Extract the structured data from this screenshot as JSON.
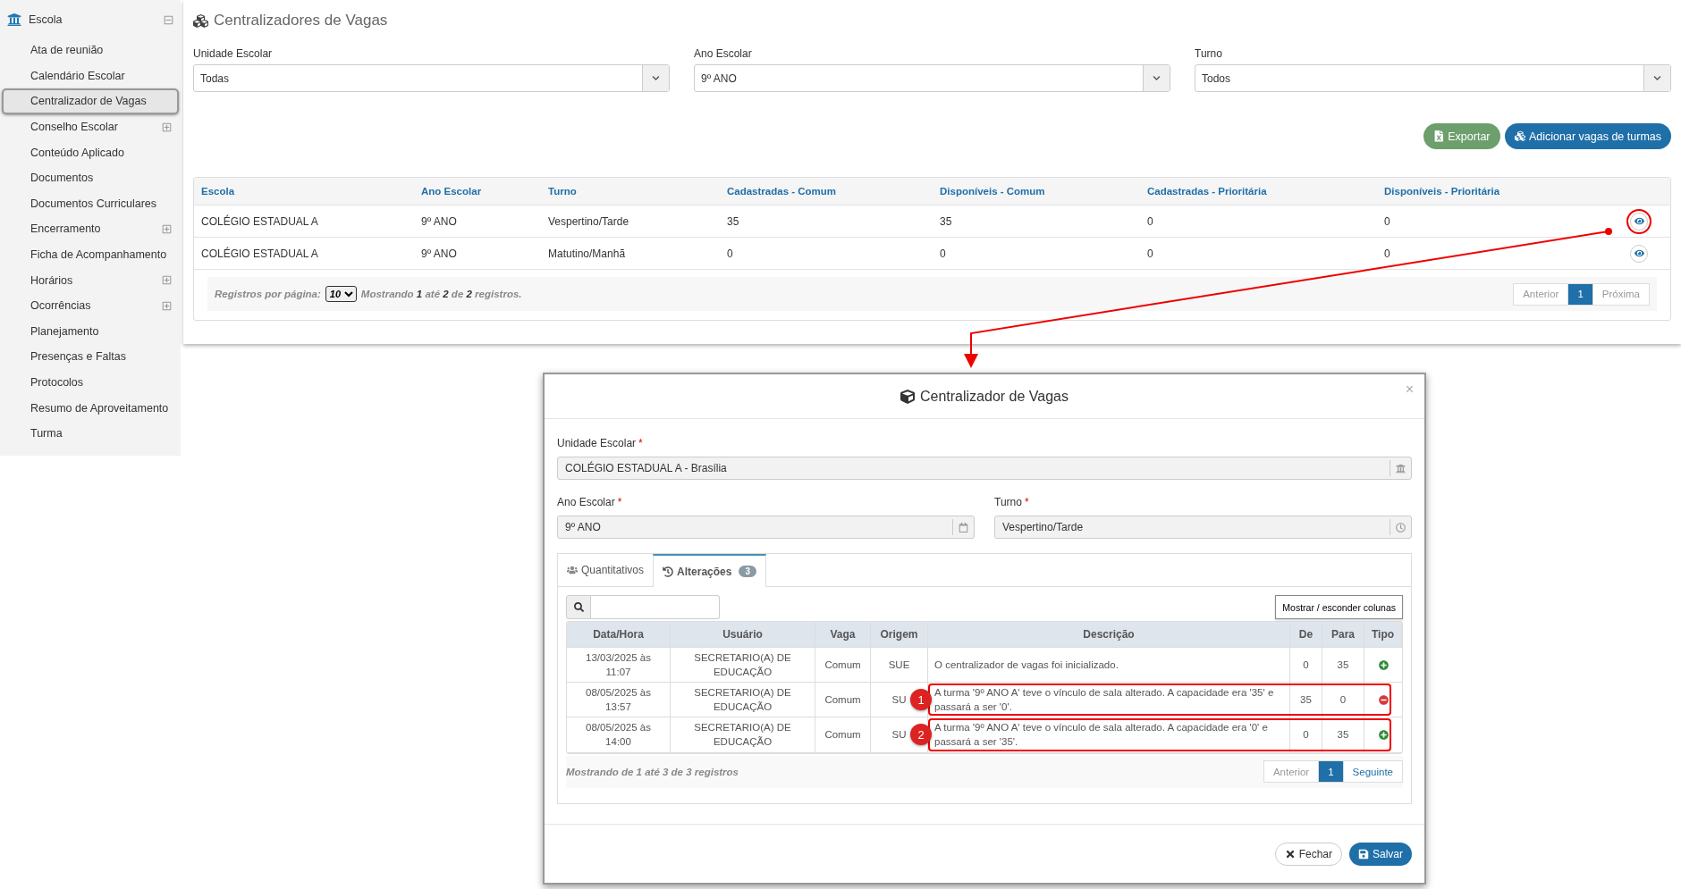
{
  "sidebar": {
    "section": {
      "label": "Escola",
      "expanded": true
    },
    "items": [
      {
        "label": "Ata de reunião",
        "selected": false,
        "expandable": false
      },
      {
        "label": "Calendário Escolar",
        "selected": false,
        "expandable": false
      },
      {
        "label": "Centralizador de Vagas",
        "selected": true,
        "expandable": false
      },
      {
        "label": "Conselho Escolar",
        "selected": false,
        "expandable": true
      },
      {
        "label": "Conteúdo Aplicado",
        "selected": false,
        "expandable": false
      },
      {
        "label": "Documentos",
        "selected": false,
        "expandable": false
      },
      {
        "label": "Documentos Curriculares",
        "selected": false,
        "expandable": false
      },
      {
        "label": "Encerramento",
        "selected": false,
        "expandable": true
      },
      {
        "label": "Ficha de Acompanhamento",
        "selected": false,
        "expandable": false
      },
      {
        "label": "Horários",
        "selected": false,
        "expandable": true
      },
      {
        "label": "Ocorrências",
        "selected": false,
        "expandable": true
      },
      {
        "label": "Planejamento",
        "selected": false,
        "expandable": false
      },
      {
        "label": "Presenças e Faltas",
        "selected": false,
        "expandable": false
      },
      {
        "label": "Protocolos",
        "selected": false,
        "expandable": false
      },
      {
        "label": "Resumo de Aproveitamento",
        "selected": false,
        "expandable": false
      },
      {
        "label": "Turma",
        "selected": false,
        "expandable": false
      }
    ]
  },
  "main": {
    "title": "Centralizadores de Vagas",
    "filters": [
      {
        "label": "Unidade Escolar",
        "value": "Todas"
      },
      {
        "label": "Ano Escolar",
        "value": "9º ANO"
      },
      {
        "label": "Turno",
        "value": "Todos"
      }
    ],
    "buttons": [
      {
        "label": "Exportar",
        "kind": "export"
      },
      {
        "label": "Adicionar vagas de turmas",
        "kind": "add"
      }
    ],
    "table": {
      "columns": [
        "Escola",
        "Ano Escolar",
        "Turno",
        "Cadastradas - Comum",
        "Disponíveis - Comum",
        "Cadastradas - Prioritária",
        "Disponíveis - Prioritária"
      ],
      "rows": [
        {
          "cells": [
            "COLÉGIO ESTADUAL A",
            "9º ANO",
            "Vespertino/Tarde",
            "35",
            "35",
            "0",
            "0"
          ],
          "highlighted": true
        },
        {
          "cells": [
            "COLÉGIO ESTADUAL A",
            "9º ANO",
            "Matutino/Manhã",
            "0",
            "0",
            "0",
            "0"
          ],
          "highlighted": false
        }
      ],
      "per_page_label": "Registros por página:",
      "per_page": "10",
      "info": "Mostrando **1** até **2** de **2** registros.",
      "pagination": [
        {
          "label": "Anterior",
          "selected": false
        },
        {
          "label": "1",
          "selected": true
        },
        {
          "label": "Próxima",
          "selected": false
        }
      ]
    }
  },
  "modal": {
    "title": "Centralizador de Vagas",
    "close": "×",
    "fields": [
      {
        "label": "Unidade Escolar",
        "required_mark": "*",
        "value": "COLÉGIO ESTADUAL A - Brasília",
        "kind": "school"
      },
      {
        "label": "Ano Escolar",
        "required_mark": "*",
        "value": "9º ANO",
        "kind": "calendar"
      },
      {
        "label": "Turno",
        "required_mark": "*",
        "value": "Vespertino/Tarde",
        "kind": "clock"
      }
    ],
    "tabs": [
      {
        "label": "Quantitativos",
        "selected": false,
        "kind": "users"
      },
      {
        "label": "Alterações",
        "selected": true,
        "kind": "history",
        "badge": "3"
      }
    ],
    "columns_button": "Mostrar / esconder colunas",
    "table": {
      "columns": [
        "Data/Hora",
        "Usuário",
        "Vaga",
        "Origem",
        "Descrição",
        "De",
        "Para",
        "Tipo"
      ],
      "rows": [
        {
          "cells": [
            "13/03/2025 às 11:07",
            "SECRETARIO(A) DE EDUCAÇÃO",
            "Comum",
            "SUE",
            "O centralizador de vagas foi inicializado.",
            "0",
            "35"
          ],
          "kind": "increase"
        },
        {
          "cells": [
            "08/05/2025 às 13:57",
            "SECRETARIO(A) DE EDUCAÇÃO",
            "Comum",
            "SU",
            "A turma '9º ANO A' teve o vínculo de sala alterado. A capacidade era '35' e passará a ser '0'.",
            "35",
            "0"
          ],
          "kind": "decrease",
          "callout": "1"
        },
        {
          "cells": [
            "08/05/2025 às 14:00",
            "SECRETARIO(A) DE EDUCAÇÃO",
            "Comum",
            "SU",
            "A turma '9º ANO A' teve o vínculo de sala alterado. A capacidade era '0' e passará a ser '35'.",
            "0",
            "35"
          ],
          "kind": "increase",
          "callout": "2"
        }
      ],
      "info": "Mostrando de 1 até 3 de 3 registros",
      "pagination": [
        {
          "label": "Anterior",
          "selected": false
        },
        {
          "label": "1",
          "selected": true
        },
        {
          "label": "Seguinte",
          "selected": false
        }
      ]
    },
    "buttons": [
      {
        "label": "Fechar",
        "kind": "close"
      },
      {
        "label": "Salvar",
        "kind": "save"
      }
    ]
  }
}
